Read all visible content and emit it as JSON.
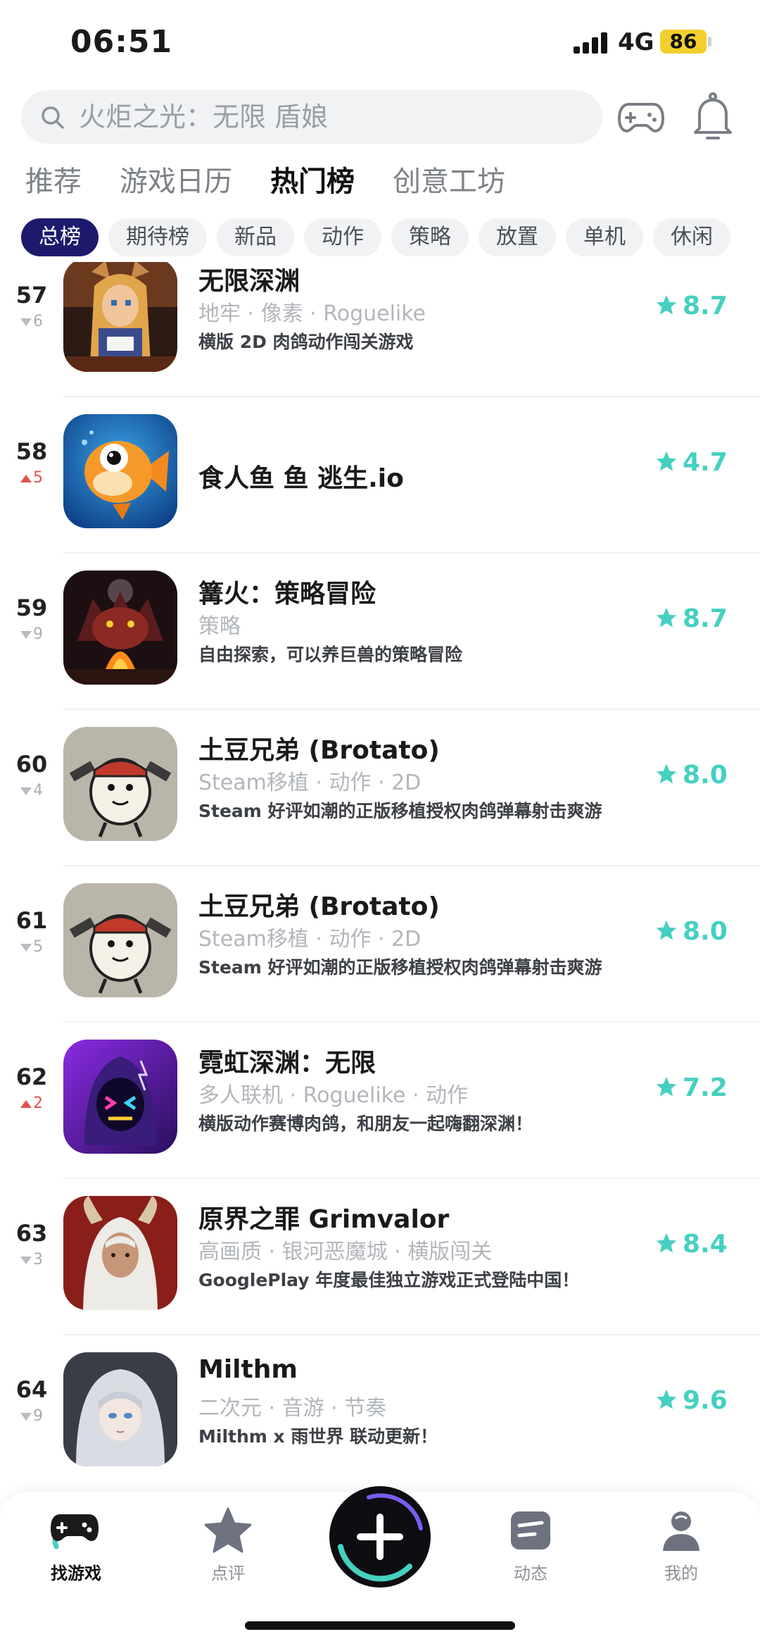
{
  "status_bar": {
    "time": "06:51",
    "network": "4G",
    "battery": "86"
  },
  "search": {
    "placeholder": "火炬之光：无限 盾娘"
  },
  "tabs": [
    {
      "label": "推荐",
      "active": false
    },
    {
      "label": "游戏日历",
      "active": false
    },
    {
      "label": "热门榜",
      "active": true
    },
    {
      "label": "创意工坊",
      "active": false
    }
  ],
  "chips": [
    {
      "label": "总榜",
      "active": true
    },
    {
      "label": "期待榜",
      "active": false
    },
    {
      "label": "新品",
      "active": false
    },
    {
      "label": "动作",
      "active": false
    },
    {
      "label": "策略",
      "active": false
    },
    {
      "label": "放置",
      "active": false
    },
    {
      "label": "单机",
      "active": false
    },
    {
      "label": "休闲",
      "active": false
    }
  ],
  "games": [
    {
      "rank": "57",
      "trend": "down",
      "change": "6",
      "title": "无限深渊",
      "tags": "地牢 · 像素 · Roguelike",
      "desc": "横版 2D 肉鸽动作闯关游戏",
      "score": "8.7",
      "icon": "pixel-girl-icon"
    },
    {
      "rank": "58",
      "trend": "up",
      "change": "5",
      "title": "食人鱼 鱼 逃生.io",
      "tags": "",
      "desc": "",
      "score": "4.7",
      "icon": "goldfish-icon"
    },
    {
      "rank": "59",
      "trend": "down",
      "change": "9",
      "title": "篝火：策略冒险",
      "tags": "策略",
      "desc": "自由探索，可以养巨兽的策略冒险",
      "score": "8.7",
      "icon": "campfire-beast-icon"
    },
    {
      "rank": "60",
      "trend": "down",
      "change": "4",
      "title": "土豆兄弟 (Brotato)",
      "tags": "Steam移植 · 动作 · 2D",
      "desc": "Steam 好评如潮的正版移植授权肉鸽弹幕射击爽游",
      "score": "8.0",
      "icon": "potato-gunner-icon"
    },
    {
      "rank": "61",
      "trend": "down",
      "change": "5",
      "title": "土豆兄弟 (Brotato)",
      "tags": "Steam移植 · 动作 · 2D",
      "desc": "Steam 好评如潮的正版移植授权肉鸽弹幕射击爽游",
      "score": "8.0",
      "icon": "potato-gunner-icon"
    },
    {
      "rank": "62",
      "trend": "up",
      "change": "2",
      "title": "霓虹深渊：无限",
      "tags": "多人联机 · Roguelike · 动作",
      "desc": "横版动作赛博肉鸽，和朋友一起嗨翻深渊！",
      "score": "7.2",
      "icon": "neon-hood-icon"
    },
    {
      "rank": "63",
      "trend": "down",
      "change": "3",
      "title": "原界之罪 Grimvalor",
      "tags": "高画质 · 银河恶魔城 · 横版闯关",
      "desc": "GooglePlay 年度最佳独立游戏正式登陆中国！",
      "score": "8.4",
      "icon": "horned-woman-icon"
    },
    {
      "rank": "64",
      "trend": "down",
      "change": "9",
      "title": "Milthm",
      "tags": "二次元 · 音游 · 节奏",
      "desc": "Milthm x 雨世界 联动更新！",
      "score": "9.6",
      "icon": "anime-girl-icon"
    }
  ],
  "bottom_nav": [
    {
      "label": "找游戏",
      "icon": "gamepad-nav-icon",
      "active": true
    },
    {
      "label": "点评",
      "icon": "star-nav-icon",
      "active": false
    },
    {
      "label": "动态",
      "icon": "feed-nav-icon",
      "active": false
    },
    {
      "label": "我的",
      "icon": "profile-nav-icon",
      "active": false
    }
  ],
  "colors": {
    "accent": "#45d0c0",
    "chip_active": "#1d1a6e",
    "rank_up": "#e0534b",
    "rank_down": "#b8bcc3"
  }
}
